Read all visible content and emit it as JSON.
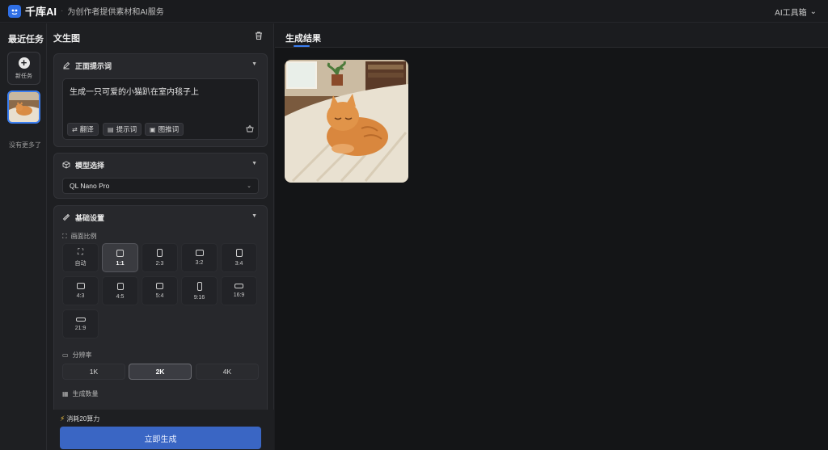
{
  "header": {
    "brand": "千库AI",
    "slogan": "为创作者提供素材和AI服务",
    "tools_label": "AI工具箱"
  },
  "rail": {
    "title": "最近任务",
    "new_task_label": "新任务",
    "no_more_label": "没有更多了"
  },
  "panel": {
    "title": "文生图",
    "prompt_section": {
      "title": "正面提示词",
      "value": "生成一只可爱的小猫趴在室内毯子上",
      "chips": [
        "翻译",
        "提示词",
        "图推词"
      ]
    },
    "model_section": {
      "title": "模型选择",
      "selected": "QL Nano Pro"
    },
    "basic_section": {
      "title": "基础设置",
      "ratio_label": "画面比例",
      "ratios": [
        "自动",
        "1:1",
        "2:3",
        "3:2",
        "3:4",
        "4:3",
        "4:5",
        "5:4",
        "9:16",
        "16:9",
        "21:9"
      ],
      "selected_ratio": "1:1",
      "resolution_label": "分辨率",
      "resolutions": [
        "1K",
        "2K",
        "4K"
      ],
      "selected_resolution": "2K",
      "count_label": "生成数量"
    },
    "cost_label": "消耗20算力",
    "generate_label": "立即生成"
  },
  "result": {
    "tab_label": "生成结果"
  },
  "colors": {
    "accent": "#3b7ef0",
    "button": "#3a66c4",
    "background": "#1b1c1f"
  }
}
